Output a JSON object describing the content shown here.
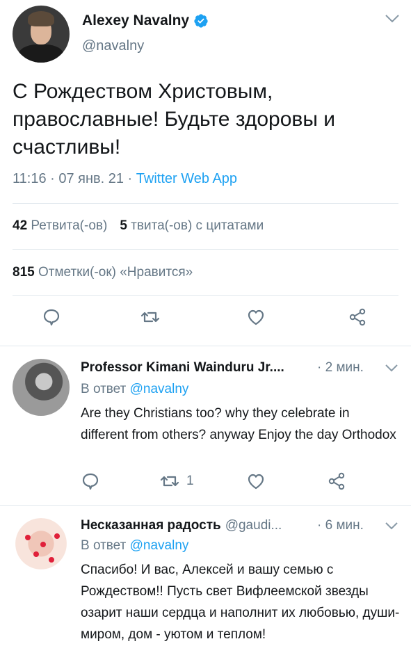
{
  "main": {
    "name": "Alexey Navalny",
    "handle": "@navalny",
    "text": "С Рождеством Христовым, православные! Будьте здоровы и счастливы!",
    "time": "11:16 · 07 янв. 21 · ",
    "app": "Twitter Web App",
    "retweets_count": "42",
    "retweets_label": "Ретвита(-ов)",
    "quotes_count": "5",
    "quotes_label": "твита(-ов) с цитатами",
    "likes_count": "815",
    "likes_label": "Отметки(-ок) «Нравится»"
  },
  "replies": [
    {
      "name": "Professor Kimani Wainduru Jr....",
      "handle": "",
      "time": "· 2 мин.",
      "reply_prefix": "В ответ ",
      "reply_to": "@navalny",
      "text": "Are they Christians too? why they celebrate in different from others? anyway Enjoy the day Orthodox",
      "retweet_count": "1"
    },
    {
      "name": "Несказанная радость",
      "handle": "@gaudi...",
      "time": "· 6 мин.",
      "reply_prefix": "В ответ ",
      "reply_to": "@navalny",
      "text": "Спасибо! И вас, Алексей и вашу семью с Рождеством!! Пусть свет Вифлеемской звезды озарит наши сердца и наполнит их любовью, души-миром, дом - уютом и теплом!"
    }
  ],
  "colors": {
    "accent": "#1da1f2",
    "secondary_text": "#657786",
    "divider": "#e1e8ed"
  },
  "icons": [
    "verified-icon",
    "chevron-down-icon",
    "reply-icon",
    "retweet-icon",
    "like-icon",
    "share-icon"
  ]
}
